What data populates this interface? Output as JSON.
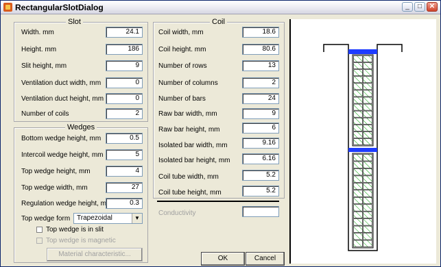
{
  "window": {
    "title": "RectangularSlotDialog"
  },
  "slot": {
    "title": "Slot",
    "fields": [
      {
        "label": "Width. mm",
        "value": "24.1"
      },
      {
        "label": "Height. mm",
        "value": "186"
      },
      {
        "label": "Slit height, mm",
        "value": "9"
      },
      {
        "label": "Ventilation duct width, mm",
        "value": "0"
      },
      {
        "label": "Ventilation duct height, mm",
        "value": "0"
      },
      {
        "label": "Number of coils",
        "value": "2"
      }
    ]
  },
  "wedges": {
    "title": "Wedges",
    "fields": [
      {
        "label": "Bottom wedge height, mm",
        "value": "0.5"
      },
      {
        "label": "Intercoil wedge height, mm",
        "value": "5"
      },
      {
        "label": "Top wedge height, mm",
        "value": "4"
      },
      {
        "label": "Top wedge width, mm",
        "value": "27"
      },
      {
        "label": "Regulation wedge height, mm",
        "value": "0.3"
      }
    ],
    "form_label": "Top wedge form",
    "form_value": "Trapezoidal",
    "in_slit_label": "Top wedge is in slit",
    "magnetic_label": "Top wedge is magnetic",
    "material_button": "Material characteristic..."
  },
  "coil": {
    "title": "Coil",
    "fields": [
      {
        "label": "Coil width, mm",
        "value": "18.6"
      },
      {
        "label": "Coil height. mm",
        "value": "80.6"
      },
      {
        "label": "Number of rows",
        "value": "13"
      },
      {
        "label": "Number of columns",
        "value": "2"
      },
      {
        "label": "Number of bars",
        "value": "24"
      },
      {
        "label": "Raw bar width, mm",
        "value": "9"
      },
      {
        "label": "Raw bar height, mm",
        "value": "6"
      },
      {
        "label": "Isolated bar width, mm",
        "value": "9.16"
      },
      {
        "label": "Isolated bar height, mm",
        "value": "6.16"
      },
      {
        "label": "Coil tube width, mm",
        "value": "5.2"
      },
      {
        "label": "Coil tube height, mm",
        "value": "5.2"
      }
    ],
    "conductivity_label": "Conductivity",
    "conductivity_value": ""
  },
  "buttons": {
    "ok": "OK",
    "cancel": "Cancel"
  },
  "colors": {
    "wedge": "#1e3cff",
    "tube": "#00a000",
    "outline": "#000000"
  }
}
